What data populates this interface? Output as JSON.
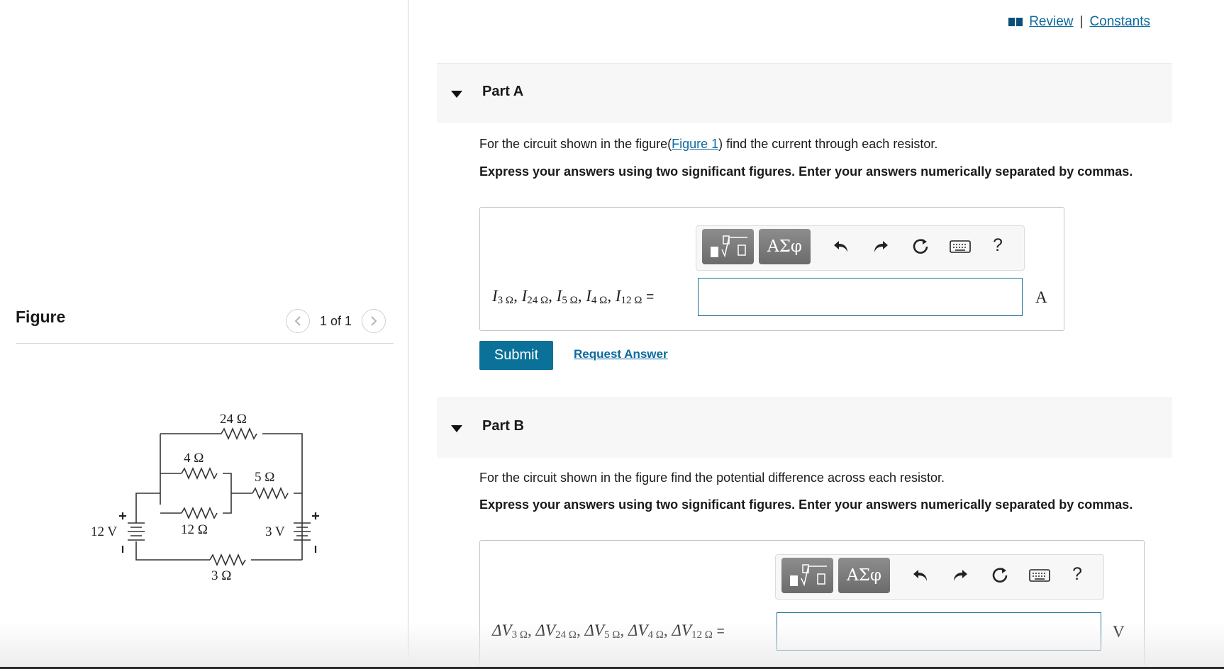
{
  "figure_panel": {
    "title": "Figure",
    "pager_text": "1 of 1",
    "circuit_labels": {
      "r24": "24 Ω",
      "r4": "4 Ω",
      "r5": "5 Ω",
      "r12": "12 Ω",
      "r3": "3 Ω",
      "v12": "12 V",
      "v3": "3 V",
      "plus": "+"
    }
  },
  "top_links": {
    "review": "Review",
    "separator": "|",
    "constants": "Constants"
  },
  "part_a": {
    "label": "Part A",
    "question_prefix": "For the circuit shown in the figure(",
    "figure_link": "Figure 1",
    "question_suffix": ") find the current through each resistor.",
    "instruction": "Express your answers using two significant figures. Enter your answers numerically separated by commas.",
    "expr": {
      "sym": "I",
      "subs": [
        "3 Ω",
        "24 Ω",
        "5 Ω",
        "4 Ω",
        "12 Ω"
      ],
      "equals": "="
    },
    "input_value": "",
    "unit": "A",
    "submit": "Submit",
    "request_answer": "Request Answer"
  },
  "part_b": {
    "label": "Part B",
    "question": "For the circuit shown in the figure find the potential difference across each resistor.",
    "instruction": "Express your answers using two significant figures. Enter your answers numerically separated by commas.",
    "expr": {
      "sym": "ΔV",
      "subs": [
        "3 Ω",
        "24 Ω",
        "5 Ω",
        "4 Ω",
        "12 Ω"
      ],
      "equals": "="
    },
    "input_value": "",
    "unit": "V"
  },
  "toolbar": {
    "templates_icon": "fraction-sqrt-templates-icon",
    "greek_label": "ΑΣφ",
    "undo_icon": "undo-icon",
    "redo_icon": "redo-icon",
    "reset_icon": "reset-icon",
    "keyboard_icon": "keyboard-icon",
    "help_label": "?"
  },
  "colors": {
    "link": "#0b6a9e",
    "submit_bg": "#0b7199",
    "input_border": "#1b6e93"
  }
}
